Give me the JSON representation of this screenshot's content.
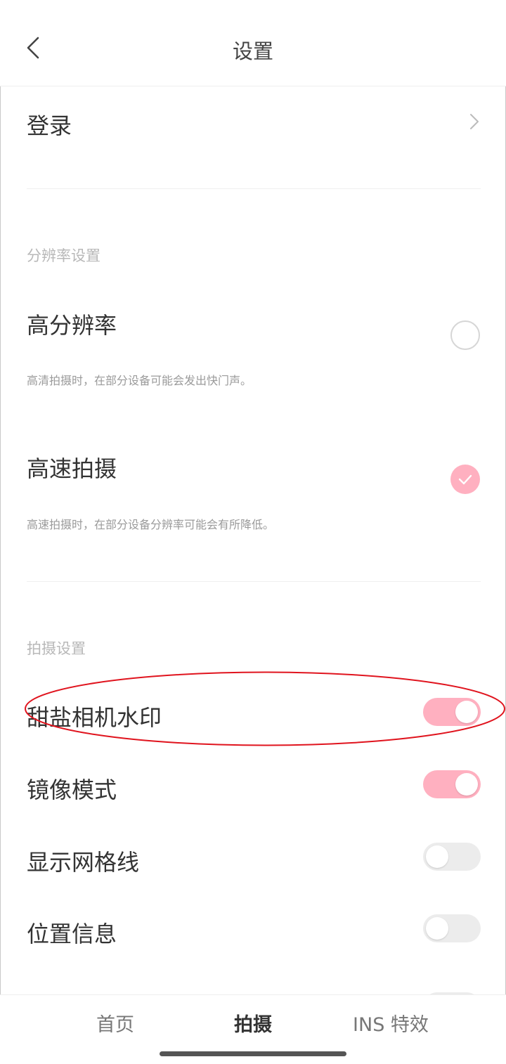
{
  "header": {
    "title": "设置"
  },
  "login": {
    "label": "登录"
  },
  "resolution_section": {
    "title": "分辨率设置",
    "options": [
      {
        "label": "高分辨率",
        "desc": "高清拍摄时，在部分设备可能会发出快门声。",
        "selected": false
      },
      {
        "label": "高速拍摄",
        "desc": "高速拍摄时，在部分设备分辨率可能会有所降低。",
        "selected": true
      }
    ]
  },
  "shooting_section": {
    "title": "拍摄设置",
    "toggles": [
      {
        "label": "甜盐相机水印",
        "on": true
      },
      {
        "label": "镜像模式",
        "on": true
      },
      {
        "label": "显示网格线",
        "on": false
      },
      {
        "label": "位置信息",
        "on": false
      }
    ]
  },
  "bottom_nav": {
    "tabs": [
      {
        "label": "首页",
        "active": false
      },
      {
        "label": "拍摄",
        "active": true
      },
      {
        "label": "INS 特效",
        "active": false
      }
    ]
  },
  "colors": {
    "accent": "#ffb0c0",
    "annotation": "#e0141e"
  }
}
